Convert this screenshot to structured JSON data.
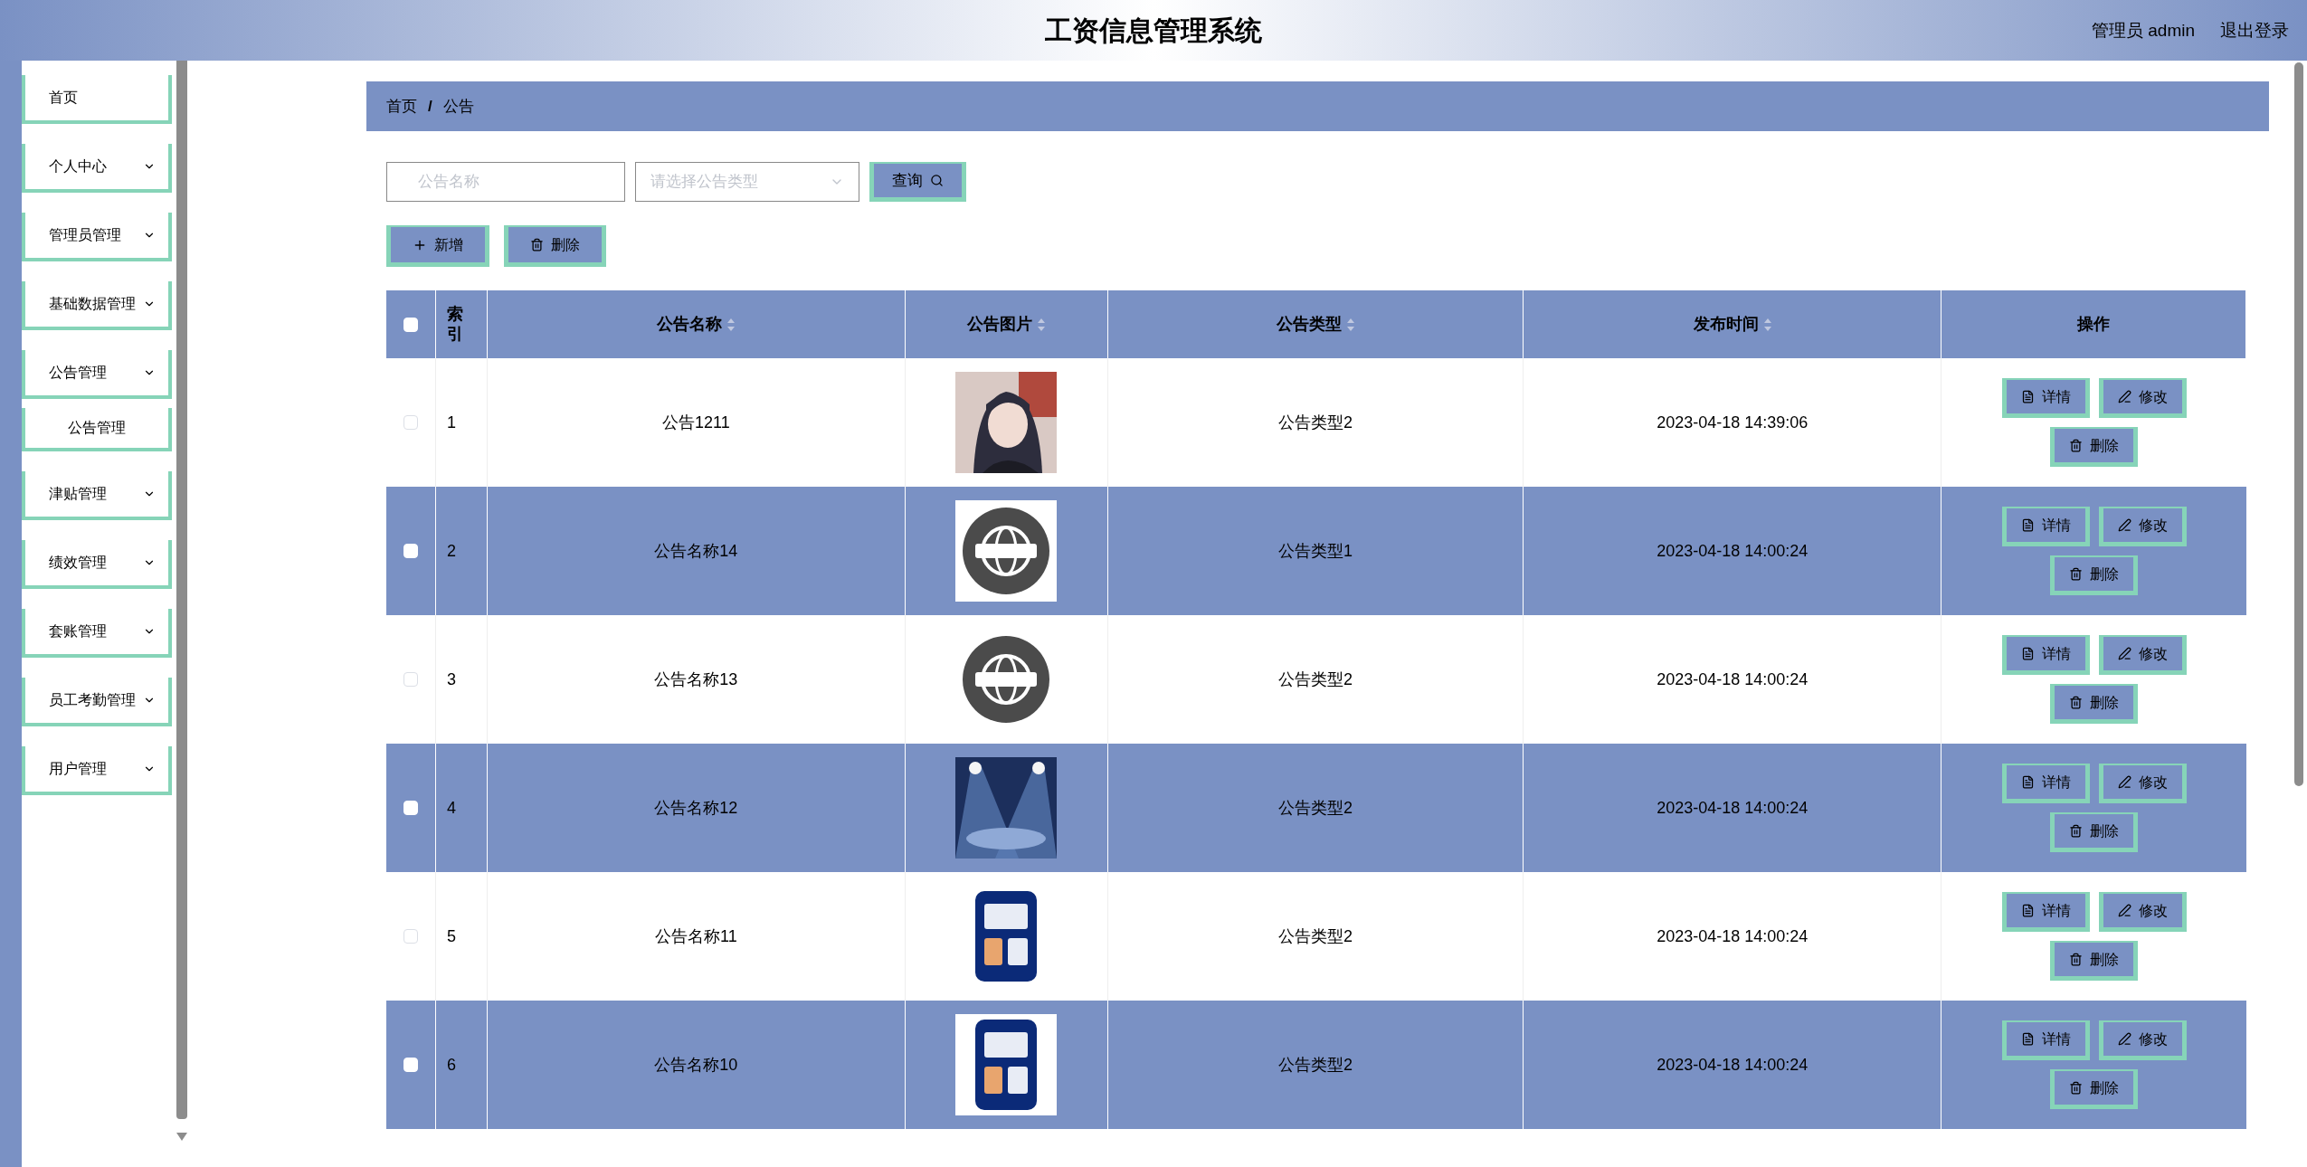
{
  "header": {
    "title": "工资信息管理系统",
    "user": "管理员 admin",
    "logout": "退出登录"
  },
  "sidebar": {
    "items": [
      {
        "label": "首页",
        "has_arrow": false
      },
      {
        "label": "个人中心",
        "has_arrow": true
      },
      {
        "label": "管理员管理",
        "has_arrow": true
      },
      {
        "label": "基础数据管理",
        "has_arrow": true
      },
      {
        "label": "公告管理",
        "has_arrow": true,
        "children": [
          {
            "label": "公告管理"
          }
        ]
      },
      {
        "label": "津贴管理",
        "has_arrow": true
      },
      {
        "label": "绩效管理",
        "has_arrow": true
      },
      {
        "label": "套账管理",
        "has_arrow": true
      },
      {
        "label": "员工考勤管理",
        "has_arrow": true
      },
      {
        "label": "用户管理",
        "has_arrow": true
      }
    ]
  },
  "breadcrumb": {
    "items": [
      "首页",
      "公告"
    ],
    "separator": "/"
  },
  "search": {
    "name_placeholder": "公告名称",
    "type_placeholder": "请选择公告类型",
    "query_button": "查询"
  },
  "actions": {
    "add": "新增",
    "delete": "删除"
  },
  "table": {
    "all_checked": false,
    "columns": [
      {
        "label": "索引",
        "sortable": false
      },
      {
        "label": "公告名称",
        "sortable": true
      },
      {
        "label": "公告图片",
        "sortable": true
      },
      {
        "label": "公告类型",
        "sortable": true
      },
      {
        "label": "发布时间",
        "sortable": true
      },
      {
        "label": "操作",
        "sortable": false
      }
    ],
    "rows": [
      {
        "index": "1",
        "name": "公告1211",
        "type": "公告类型2",
        "time": "2023-04-18 14:39:06",
        "checked": false,
        "buttons": {
          "detail": "详情",
          "edit": "修改",
          "delete": "删除"
        }
      },
      {
        "index": "2",
        "name": "公告名称14",
        "type": "公告类型1",
        "time": "2023-04-18 14:00:24",
        "checked": false,
        "buttons": {
          "detail": "详情",
          "edit": "修改",
          "delete": "删除"
        }
      },
      {
        "index": "3",
        "name": "公告名称13",
        "type": "公告类型2",
        "time": "2023-04-18 14:00:24",
        "checked": false,
        "buttons": {
          "detail": "详情",
          "edit": "修改",
          "delete": "删除"
        }
      },
      {
        "index": "4",
        "name": "公告名称12",
        "type": "公告类型2",
        "time": "2023-04-18 14:00:24",
        "checked": false,
        "buttons": {
          "detail": "详情",
          "edit": "修改",
          "delete": "删除"
        }
      },
      {
        "index": "5",
        "name": "公告名称11",
        "type": "公告类型2",
        "time": "2023-04-18 14:00:24",
        "checked": false,
        "buttons": {
          "detail": "详情",
          "edit": "修改",
          "delete": "删除"
        }
      },
      {
        "index": "6",
        "name": "公告名称10",
        "type": "公告类型2",
        "time": "2023-04-18 14:00:24",
        "checked": false,
        "buttons": {
          "detail": "详情",
          "edit": "修改",
          "delete": "删除"
        }
      }
    ]
  }
}
